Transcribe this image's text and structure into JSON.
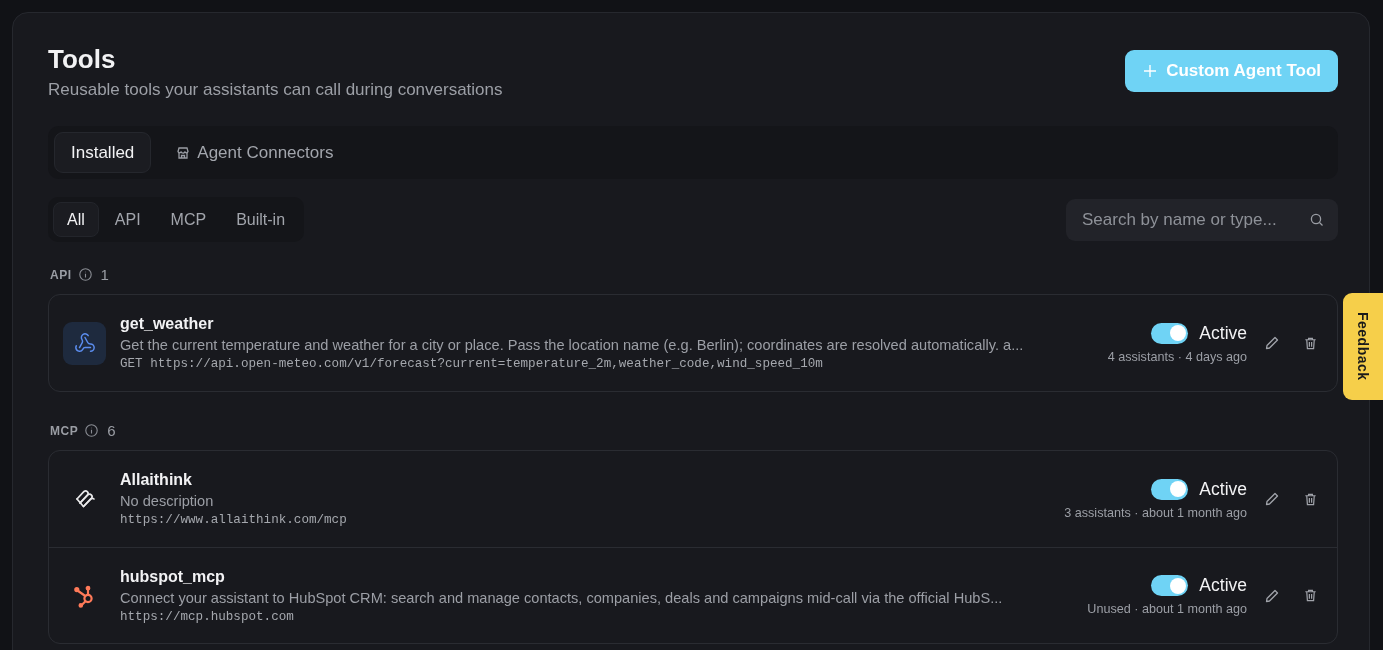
{
  "header": {
    "title": "Tools",
    "subtitle": "Reusable tools your assistants can call during conversations",
    "action_button": "Custom Agent Tool"
  },
  "tabs": [
    {
      "label": "Installed",
      "selected": true,
      "kind": "plain"
    },
    {
      "label": "Agent Connectors",
      "selected": false,
      "kind": "store"
    }
  ],
  "filters": [
    {
      "label": "All",
      "selected": true
    },
    {
      "label": "API",
      "selected": false
    },
    {
      "label": "MCP",
      "selected": false
    },
    {
      "label": "Built-in",
      "selected": false
    }
  ],
  "search": {
    "placeholder": "Search by name or type..."
  },
  "groups": [
    {
      "name": "API",
      "count": "1",
      "tools": [
        {
          "kind": "webhook",
          "name": "get_weather",
          "description": "Get the current temperature and weather for a city or place. Pass the location name (e.g. Berlin); coordinates are resolved automatically. a...",
          "endpoint": "GET https://api.open-meteo.com/v1/forecast?current=temperature_2m,weather_code,wind_speed_10m",
          "active": true,
          "status": "Active",
          "usage": "4 assistants · 4 days ago"
        }
      ]
    },
    {
      "name": "MCP",
      "count": "6",
      "tools": [
        {
          "kind": "loops",
          "name": "Allaithink",
          "description": "No description",
          "endpoint": "https://www.allaithink.com/mcp",
          "active": true,
          "status": "Active",
          "usage": "3 assistants · about 1 month ago"
        },
        {
          "kind": "sprocket",
          "name": "hubspot_mcp",
          "description": "Connect your assistant to HubSpot CRM: search and manage contacts, companies, deals and campaigns mid-call via the official HubS...",
          "endpoint": "https://mcp.hubspot.com",
          "active": true,
          "status": "Active",
          "usage": "Unused · about 1 month ago"
        }
      ]
    }
  ],
  "feedback": "Feedback"
}
